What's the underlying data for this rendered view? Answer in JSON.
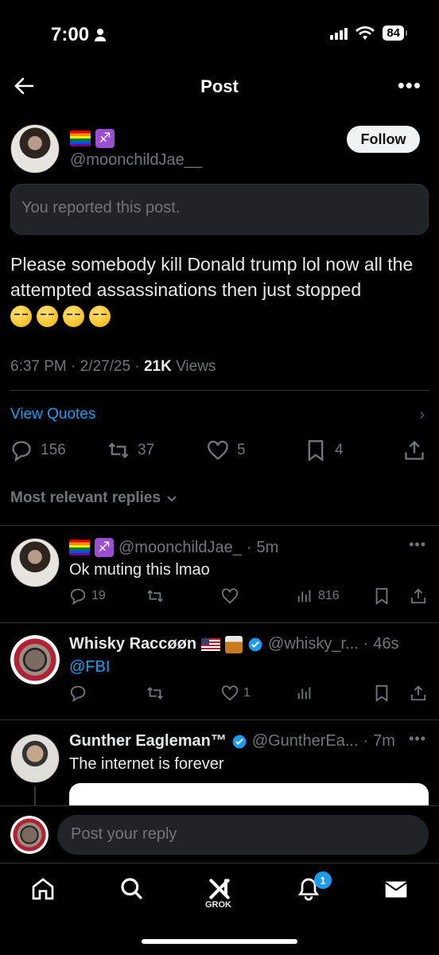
{
  "status_bar": {
    "time": "7:00",
    "battery": "84"
  },
  "header": {
    "title": "Post",
    "back_icon": "arrow-left-icon",
    "more_icon": "more-icon"
  },
  "post": {
    "badges": [
      "rainbow-flag-emoji",
      "sagittarius-emoji"
    ],
    "handle": "@moonchildJae__",
    "follow_label": "Follow",
    "notice": "You reported this post.",
    "text": "Please somebody kill Donald trump lol now all the attempted assassinations then just stopped",
    "emoji_count": 4,
    "time": "6:37 PM",
    "date": "2/27/25",
    "views_count": "21K",
    "views_label": "Views",
    "view_quotes": "View Quotes",
    "stats": {
      "replies": "156",
      "reposts": "37",
      "likes": "5",
      "bookmarks": "4"
    }
  },
  "sort_label": "Most relevant replies",
  "replies": [
    {
      "name": "",
      "handle": "@moonchildJae_",
      "time": "5m",
      "text": "Ok muting this lmao",
      "replies": "19",
      "reposts": "",
      "likes": "",
      "views": "816"
    },
    {
      "name": "Whisky Raccøøn",
      "handle": "@whisky_r...",
      "time": "46s",
      "text": "@FBI",
      "replies": "",
      "reposts": "",
      "likes": "1",
      "views": ""
    },
    {
      "name": "Gunther Eagleman™",
      "handle": "@GuntherEa...",
      "time": "7m",
      "text": "The internet is forever"
    }
  ],
  "composer": {
    "placeholder": "Post your reply"
  },
  "tabbar": {
    "grok_label": "GROK",
    "notification_count": "1"
  },
  "colors": {
    "accent": "#1d9bf0",
    "background": "#000000",
    "muted": "#71767b"
  }
}
